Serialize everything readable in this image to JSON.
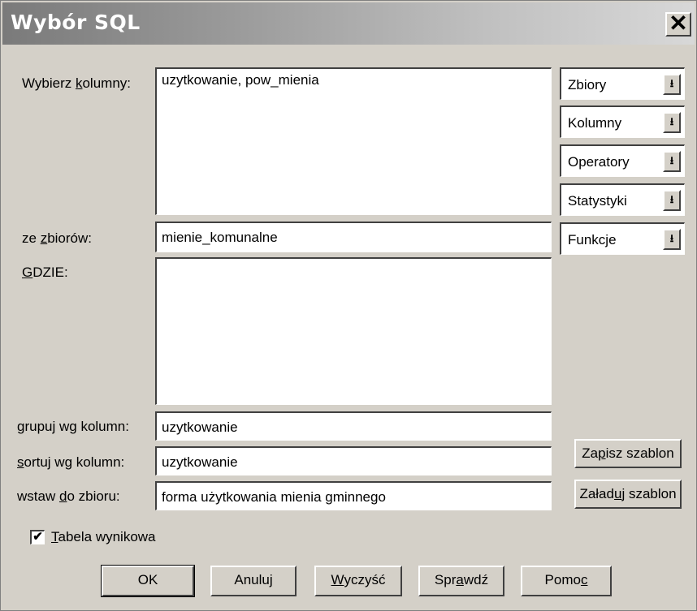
{
  "dialog": {
    "title": "Wybór SQL",
    "close_glyph": "✕"
  },
  "labels": {
    "columns_pre": "Wybierz ",
    "columns_acc": "k",
    "columns_post": "olumny:",
    "sets_pre": "ze ",
    "sets_acc": "z",
    "sets_post": "biorów:",
    "where_acc": "G",
    "where_post": "DZIE:",
    "group_pre": "",
    "group_acc": "g",
    "group_post": "rupuj wg kolumn:",
    "sort_pre": "",
    "sort_acc": "s",
    "sort_post": "ortuj wg kolumn:",
    "insert_pre": "wstaw ",
    "insert_acc": "d",
    "insert_post": "o zbioru:"
  },
  "fields": {
    "columns_value": "uzytkowanie, pow_mienia",
    "sets_value": "mienie_komunalne",
    "where_value": "",
    "group_value": "uzytkowanie",
    "sort_value": "uzytkowanie",
    "insert_value": "forma użytkowania mienia gminnego"
  },
  "dropdowns": [
    {
      "label": "Zbiory"
    },
    {
      "label": "Kolumny"
    },
    {
      "label": "Operatory"
    },
    {
      "label": "Statystyki"
    },
    {
      "label": "Funkcje"
    }
  ],
  "dropdown_arrow": "⭳",
  "side_buttons": {
    "save_pre": "Za",
    "save_acc": "p",
    "save_post": "isz szablon",
    "load_pre": "Załad",
    "load_acc": "u",
    "load_post": "j szablon"
  },
  "checkbox": {
    "checked_glyph": "✔",
    "label_acc": "T",
    "label_post": "abela wynikowa"
  },
  "bottom_buttons": {
    "ok": "OK",
    "cancel": "Anuluj",
    "clear_acc": "W",
    "clear_post": "yczyść",
    "check_pre": "Spr",
    "check_acc": "a",
    "check_post": "wdź",
    "help_pre": "Pomo",
    "help_acc": "c"
  }
}
